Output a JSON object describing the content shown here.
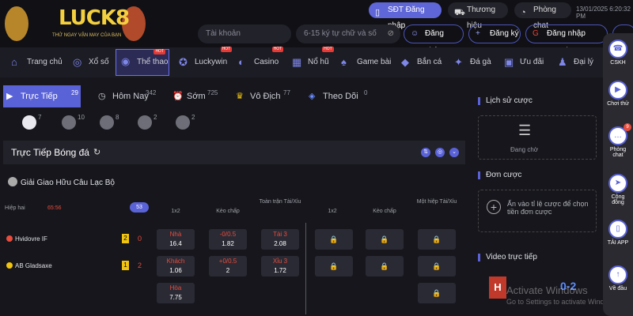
{
  "header": {
    "logo": "LUCK8",
    "logo_sub": "THỬ NGAY VẬN MAY CỦA BẠN",
    "sdt_login": "SĐT Đăng nhập",
    "brand": "Thương hiệu",
    "chat": "Phòng chat",
    "clock": "13/01/2025 6:20:32 PM",
    "account_placeholder": "Tài khoản",
    "password_placeholder": "6-15 ký tự chữ và số",
    "login": "Đăng nhập",
    "register": "Đăng ký",
    "google_login": "Đăng nhập Google"
  },
  "nav": {
    "items": [
      {
        "label": "Trang chủ",
        "icon": "home"
      },
      {
        "label": "Xổ số",
        "icon": "lottery"
      },
      {
        "label": "Thể thao",
        "icon": "sports",
        "hot": "HOT"
      },
      {
        "label": "Luckywin",
        "icon": "luckywin",
        "hot": "HOT"
      },
      {
        "label": "Casino",
        "icon": "casino",
        "hot": "HOT"
      },
      {
        "label": "Nổ hũ",
        "icon": "jackpot",
        "hot": "HOT"
      },
      {
        "label": "Game bài",
        "icon": "cards"
      },
      {
        "label": "Bắn cá",
        "icon": "fish"
      },
      {
        "label": "Đá gà",
        "icon": "rooster"
      },
      {
        "label": "Ưu đãi",
        "icon": "promo"
      },
      {
        "label": "Đại lý",
        "icon": "agent"
      }
    ]
  },
  "tabs": [
    {
      "label": "Trực Tiếp",
      "count": "29"
    },
    {
      "label": "Hôm Nay",
      "count": "342"
    },
    {
      "label": "Sớm",
      "count": "725"
    },
    {
      "label": "Vô Địch",
      "count": "77"
    },
    {
      "label": "Theo Dõi",
      "count": "0"
    }
  ],
  "sports": [
    {
      "name": "football",
      "count": "7"
    },
    {
      "name": "basketball",
      "count": "10"
    },
    {
      "name": "tennis",
      "count": "8"
    },
    {
      "name": "volleyball",
      "count": "2"
    },
    {
      "name": "table-tennis",
      "count": "2"
    }
  ],
  "section": {
    "title": "Trực Tiếp Bóng đá",
    "league": "Giải Giao Hữu Câu Lạc Bộ"
  },
  "odds_header": {
    "half": "Hiệp hai",
    "time": "65:56",
    "more": "53",
    "col_1x2": "1x2",
    "col_handicap": "Kèo chấp",
    "col_total": "Toàn trận Tài/Xỉu",
    "col_1x2_b": "1x2",
    "col_handicap_b": "Kèo chấp",
    "col_half": "Một hiệp Tài/Xỉu"
  },
  "match": {
    "home": "Hvidovre IF",
    "away": "AB Gladsaxe",
    "home_card": "2",
    "home_score": "0",
    "away_card": "1",
    "away_score": "2",
    "home_1x2_k": "Nhà",
    "home_1x2_v": "16.4",
    "home_hc_k": "-0/0.5",
    "home_hc_v": "1.82",
    "home_ou_k": "Tài 3",
    "home_ou_v": "2.08",
    "away_1x2_k": "Khách",
    "away_1x2_v": "1.06",
    "away_hc_k": "+0/0.5",
    "away_hc_v": "2",
    "away_ou_k": "Xỉu 3",
    "away_ou_v": "1.72",
    "draw_k": "Hòa",
    "draw_v": "7.75"
  },
  "right": {
    "history": "Lịch sử cược",
    "pending": "Đang chờ",
    "slip": "Đơn cược",
    "slip_hint": "Ấn vào tỉ lệ cược để chọn tiền đơn cược",
    "video": "Video trực tiếp",
    "score": "0-2"
  },
  "side": [
    {
      "label": "CSKH"
    },
    {
      "label": "Chơi thử"
    },
    {
      "label": "Phòng chat",
      "badge": "9"
    },
    {
      "label": "Cộng đồng"
    },
    {
      "label": "TẢI APP"
    },
    {
      "label": "Về đầu"
    }
  ],
  "watermark": {
    "line1": "Activate Windows",
    "line2": "Go to Settings to activate Windows."
  },
  "colors": {
    "accent": "#5a62d8",
    "odds_red": "#e74c3c",
    "score_yellow": "#f1c40f"
  }
}
